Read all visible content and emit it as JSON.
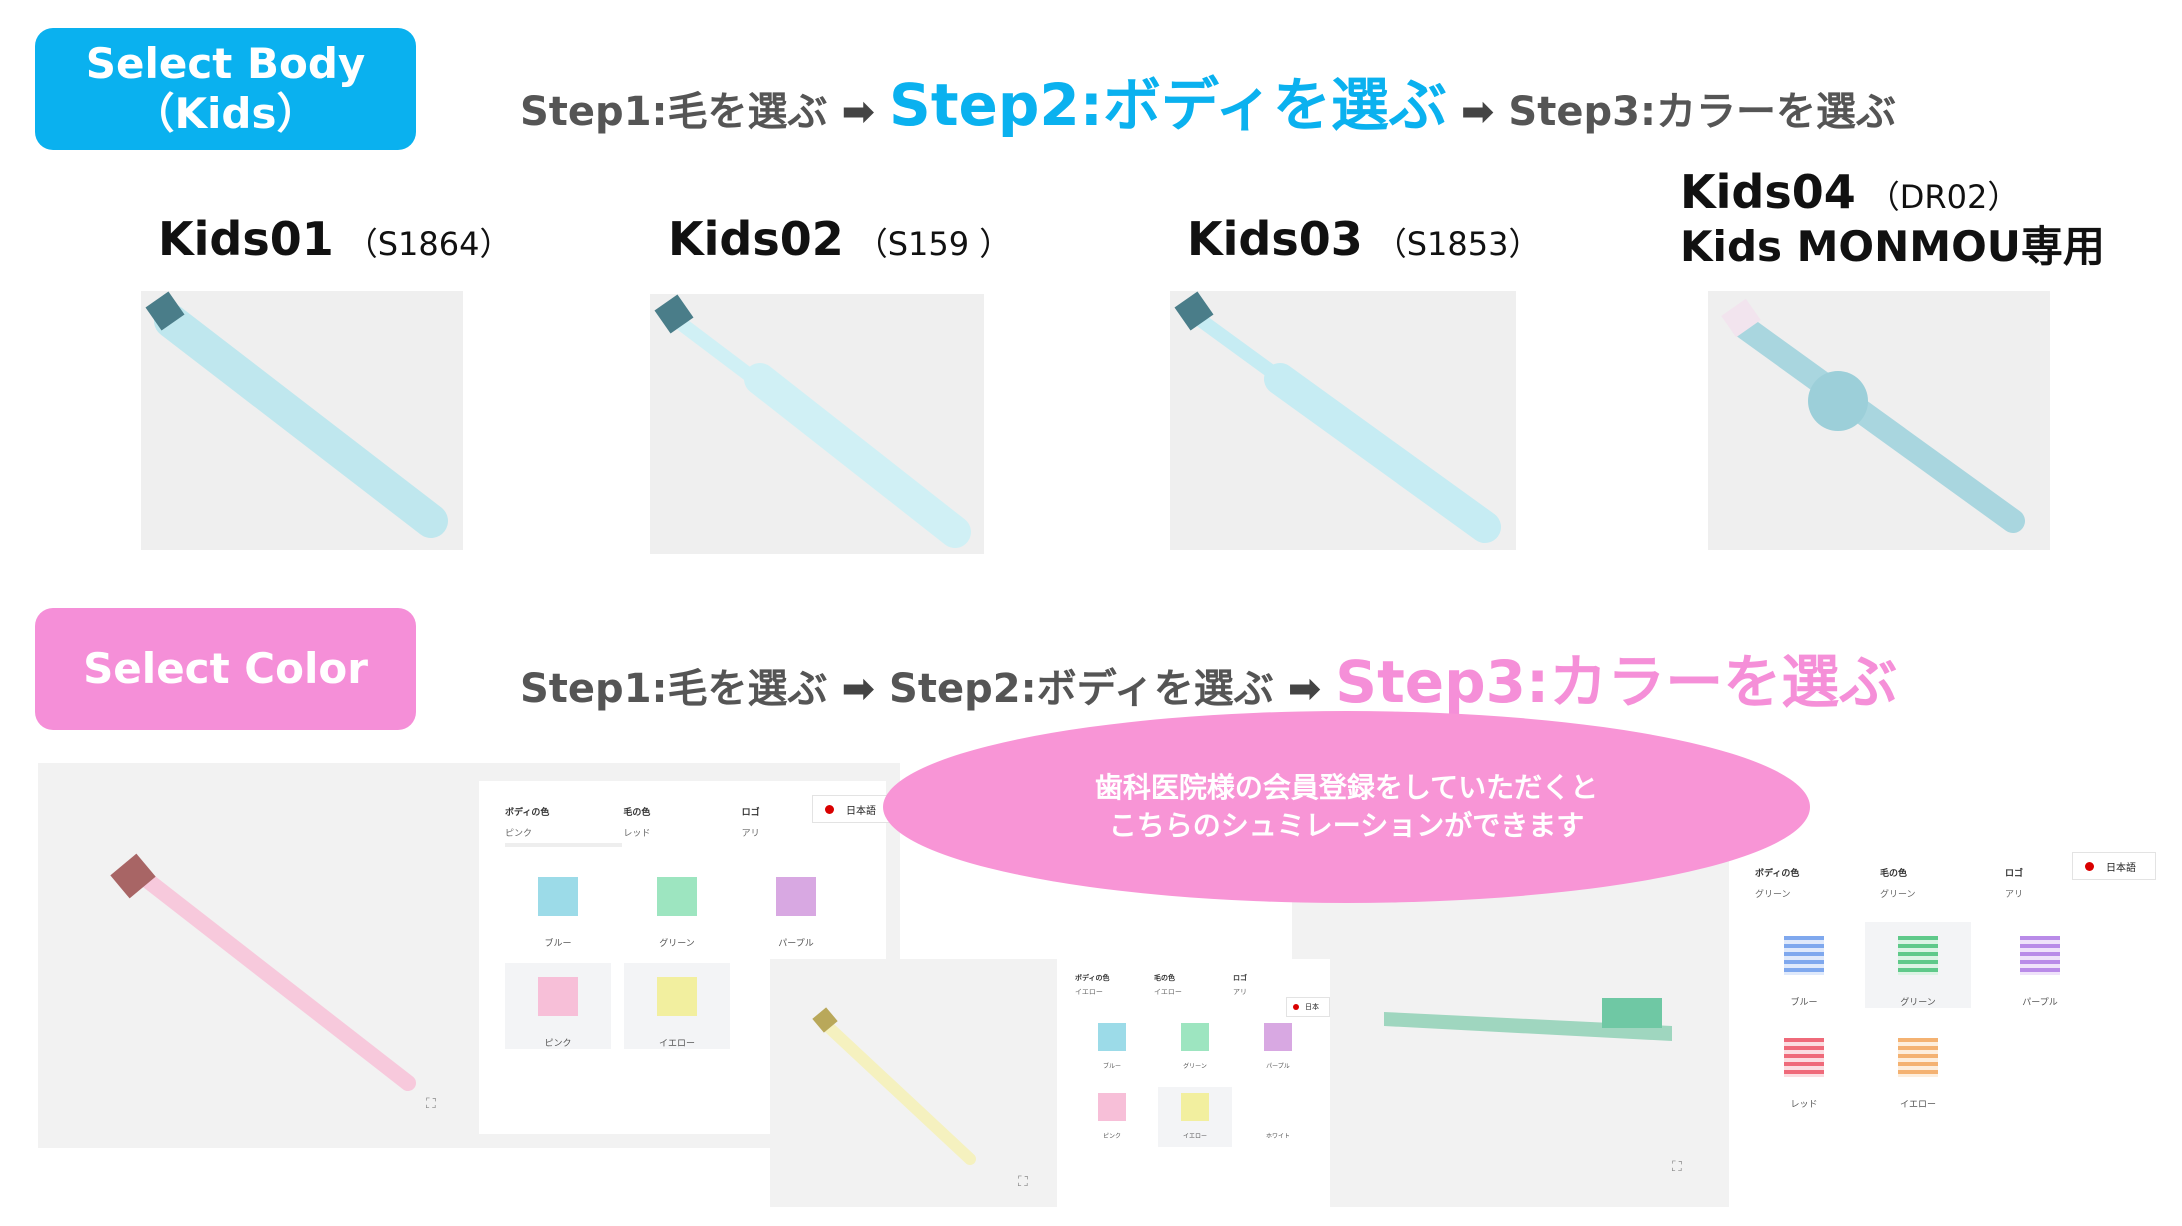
{
  "colors": {
    "body_accent": "#0ab1ef",
    "color_accent": "#f58fd8",
    "ellipse": "#f895d6",
    "step_gray": "#555555"
  },
  "body_section": {
    "button_line1": "Select Body",
    "button_line2": "（Kids）",
    "steps": [
      "Step1:毛を選ぶ",
      "Step2:ボディを選ぶ",
      "Step3:カラーを選ぶ"
    ],
    "arrow": "➡",
    "active_step": 1,
    "models": [
      {
        "name": "Kids01",
        "code": "（S1864）",
        "body_color": "#bfe7ee"
      },
      {
        "name": "Kids02",
        "code": "（S159 ）",
        "body_color": "#d0f0f5"
      },
      {
        "name": "Kids03",
        "code": "（S1853）",
        "body_color": "#c6ecf3"
      },
      {
        "name": "Kids04",
        "code": "（DR02）",
        "note": "Kids MONMOU専用",
        "body_color": "#a9d6df"
      }
    ]
  },
  "color_section": {
    "button_label": "Select Color",
    "steps": [
      "Step1:毛を選ぶ",
      "Step2:ボディを選ぶ",
      "Step3:カラーを選ぶ"
    ],
    "arrow": "➡",
    "active_step": 2,
    "callout_line1": "歯科医院様の会員登録をしていただくと",
    "callout_line2": "こちらのシュミレーションができます"
  },
  "simulators": [
    {
      "headers": [
        {
          "label": "ボディの色",
          "value": "ピンク"
        },
        {
          "label": "毛の色",
          "value": "レッド"
        },
        {
          "label": "ロゴ",
          "value": "アリ"
        }
      ],
      "language": "日本語",
      "swatches": [
        {
          "label": "ブルー",
          "color": "#9cdbe8"
        },
        {
          "label": "グリーン",
          "color": "#9de5c0"
        },
        {
          "label": "パープル",
          "color": "#d8a8e2"
        },
        {
          "label": "ピンク",
          "color": "#f7bfd8",
          "selected": true
        },
        {
          "label": "イエロー",
          "color": "#f2ef9f",
          "selected": true
        }
      ]
    },
    {
      "headers": [
        {
          "label": "ボディの色",
          "value": "イエロー"
        },
        {
          "label": "毛の色",
          "value": "イエロー"
        },
        {
          "label": "ロゴ",
          "value": "アリ"
        }
      ],
      "language": "日本",
      "swatches": [
        {
          "label": "ブルー",
          "color": "#9cdbe8"
        },
        {
          "label": "グリーン",
          "color": "#9de5c0"
        },
        {
          "label": "パープル",
          "color": "#d8a8e2"
        },
        {
          "label": "ピンク",
          "color": "#f7bfd8"
        },
        {
          "label": "イエロー",
          "color": "#f2ef9f",
          "selected": true
        },
        {
          "label": "ホワイト",
          "color": "#ffffff"
        }
      ]
    },
    {
      "headers": [
        {
          "label": "ボディの色",
          "value": "グリーン"
        },
        {
          "label": "毛の色",
          "value": "グリーン"
        },
        {
          "label": "ロゴ",
          "value": "アリ"
        }
      ],
      "language": "日本語",
      "swatches": [
        {
          "label": "ブルー",
          "color": "#7fa8ee"
        },
        {
          "label": "グリーン",
          "color": "#5fc98a",
          "selected": true
        },
        {
          "label": "パープル",
          "color": "#b98be8"
        },
        {
          "label": "レッド",
          "color": "#ef6a7a"
        },
        {
          "label": "イエロー",
          "color": "#f4b272"
        }
      ]
    }
  ]
}
